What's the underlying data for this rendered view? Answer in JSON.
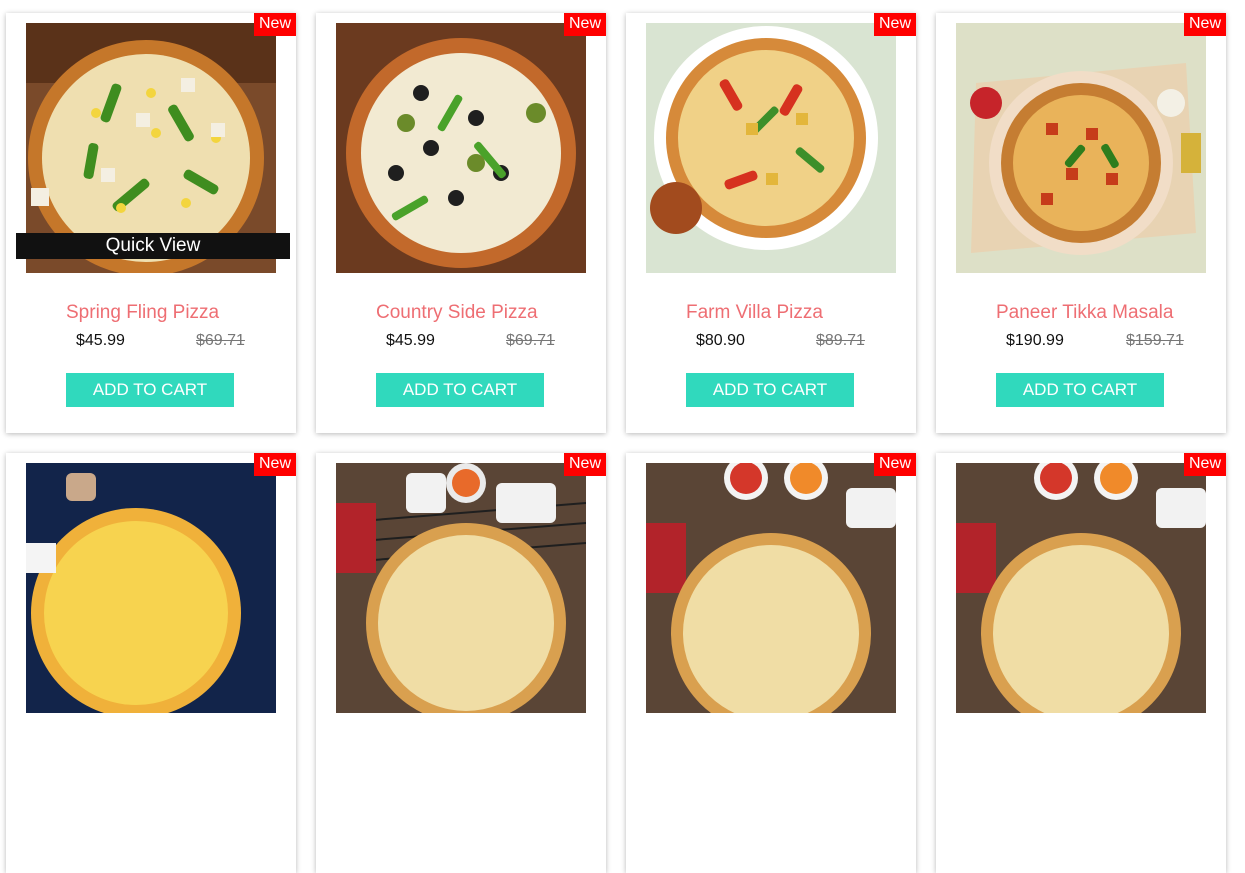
{
  "badge": "New",
  "quick_view": "Quick View",
  "add_to_cart": "ADD TO CART",
  "products": [
    {
      "name": "Spring Fling Pizza",
      "price": "$45.99",
      "old_price": "$69.71"
    },
    {
      "name": "Country Side Pizza",
      "price": "$45.99",
      "old_price": "$69.71"
    },
    {
      "name": "Farm Villa Pizza",
      "price": "$80.90",
      "old_price": "$89.71"
    },
    {
      "name": "Paneer Tikka Masala",
      "price": "$190.99",
      "old_price": "$159.71"
    }
  ],
  "colors": {
    "badge": "#ff0000",
    "title": "#ee6e73",
    "button": "#30d9bd"
  }
}
